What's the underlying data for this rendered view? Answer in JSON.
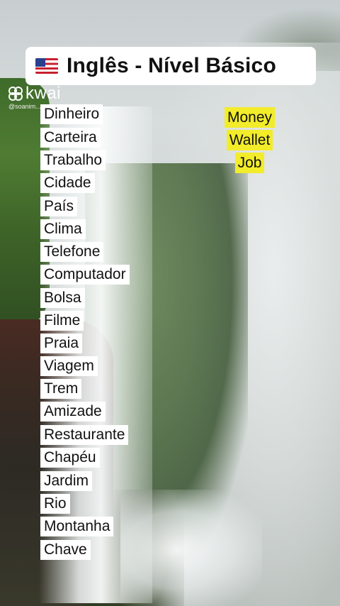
{
  "title": {
    "flag_icon": "us-flag-icon",
    "text": "Inglês - Nível Básico"
  },
  "watermark": {
    "logo_icon": "kwai-logo-icon",
    "brand": "kwai",
    "handle": "@soanim..."
  },
  "words": [
    "Dinheiro",
    "Carteira",
    "Trabalho",
    "Cidade",
    "País",
    "Clima",
    "Telefone",
    "Computador",
    "Bolsa",
    "Filme",
    "Praia",
    "Viagem",
    "Trem",
    "Amizade",
    "Restaurante",
    "Chapéu",
    "Jardim",
    "Rio",
    "Montanha",
    "Chave"
  ],
  "translations": [
    "Money",
    "Wallet",
    "Job"
  ],
  "colors": {
    "label_background": "#ffffff",
    "translation_highlight": "#f2ec2a",
    "text": "#111111"
  }
}
